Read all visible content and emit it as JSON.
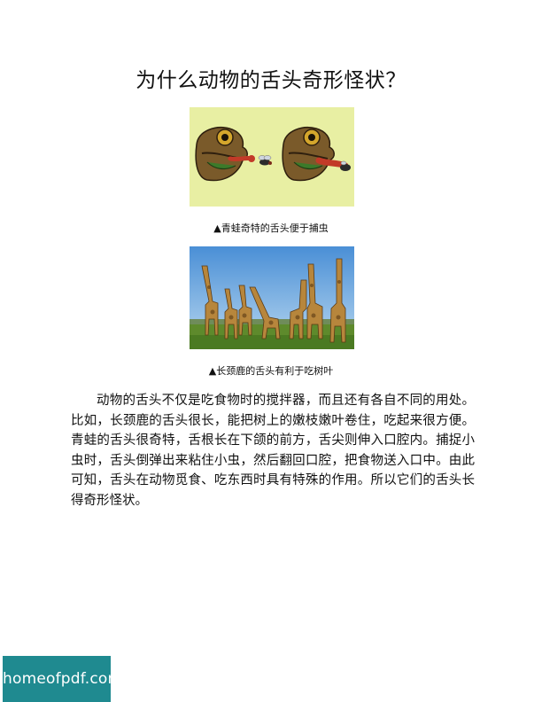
{
  "page": {
    "title": "为什么动物的舌头奇形怪状？"
  },
  "figures": [
    {
      "caption": "▲青蛙奇特的舌头便于捕虫",
      "background_color": "#e8efa3"
    },
    {
      "caption": "▲长颈鹿的舌头有利于吃树叶"
    }
  ],
  "body": {
    "paragraph": "动物的舌头不仅是吃食物时的搅拌器，而且还有各自不同的用处。比如，长颈鹿的舌头很长，能把树上的嫩枝嫩叶卷住，吃起来很方便。青蛙的舌头很奇特，舌根长在下颌的前方，舌尖则伸入口腔内。捕捉小虫时，舌头倒弹出来粘住小虫，然后翻回口腔，把食物送入口中。由此可知，舌头在动物觅食、吃东西时具有特殊的作用。所以它们的舌头长得奇形怪状。"
  },
  "watermark": {
    "text": "homeofpdf.com",
    "color": "#1f8a90"
  }
}
